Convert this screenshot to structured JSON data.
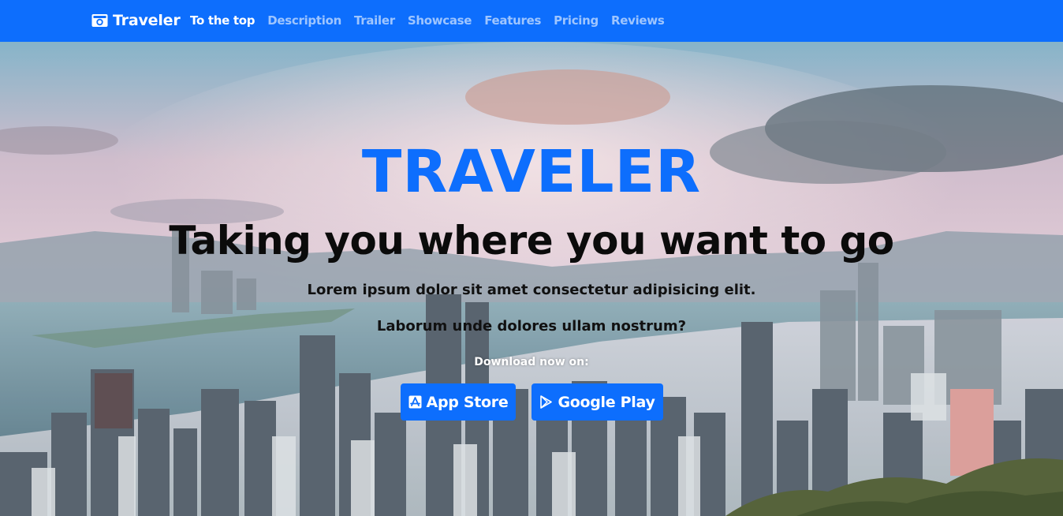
{
  "navbar": {
    "brand": "Traveler",
    "brand_icon": "camera-icon",
    "links": [
      {
        "label": "To the top",
        "active": true
      },
      {
        "label": "Description",
        "active": false
      },
      {
        "label": "Trailer",
        "active": false
      },
      {
        "label": "Showcase",
        "active": false
      },
      {
        "label": "Features",
        "active": false
      },
      {
        "label": "Pricing",
        "active": false
      },
      {
        "label": "Reviews",
        "active": false
      }
    ]
  },
  "hero": {
    "title": "TRAVELER",
    "subtitle": "Taking you where you want to go",
    "line1": "Lorem ipsum dolor sit amet consectetur adipisicing elit.",
    "line2": "Laborum unde dolores ullam nostrum?",
    "download_label": "Download now on:",
    "app_store": {
      "label": "App Store",
      "icon": "app-store-icon"
    },
    "google_play": {
      "label": "Google Play",
      "icon": "google-play-icon"
    }
  },
  "colors": {
    "primary": "#0d6efd",
    "title": "#0d6efd",
    "subtitle": "#0b0b0b"
  }
}
